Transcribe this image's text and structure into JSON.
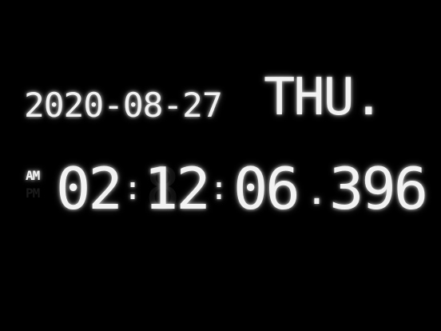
{
  "clock": {
    "date": "2020-08-27",
    "weekday": "THU.",
    "meridiem": "AM",
    "time": {
      "hours": "02",
      "colon": ":",
      "minutes": "12",
      "seconds": "06",
      "decimal_point": ".",
      "milliseconds": "396"
    }
  },
  "colors": {
    "background": "#000000",
    "digits": "#f2f2f2",
    "ghost_segments": "#111111"
  }
}
